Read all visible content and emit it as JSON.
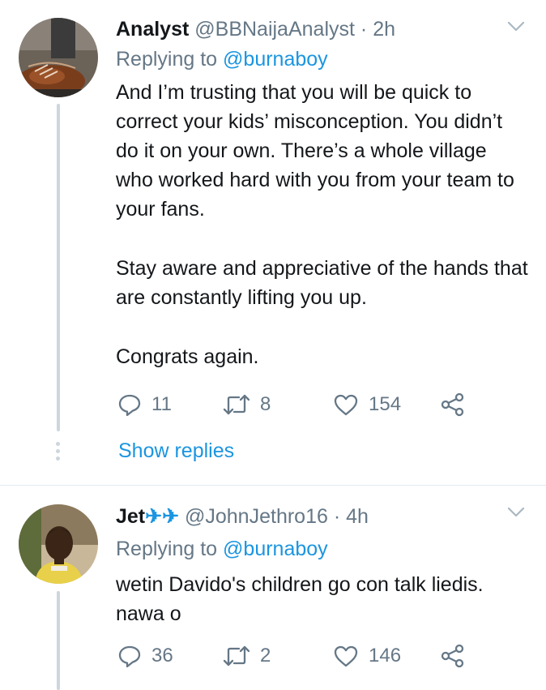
{
  "tweets": [
    {
      "name": "Analyst",
      "handle": "@BBNaijaAnalyst",
      "separator": "·",
      "time": "2h",
      "replying_prefix": "Replying to",
      "replying_to": "@burnaboy",
      "text_paragraphs": [
        "And I’m trusting that you will be quick to correct your kids’ misconception. You didn’t do it on your own. There’s a whole village who worked hard with you from your team to your fans.",
        "Stay aware and appreciative of the hands that are constantly lifting you up.",
        "Congrats again."
      ],
      "actions": {
        "replies": "11",
        "retweets": "8",
        "likes": "154"
      },
      "show_replies": "Show replies"
    },
    {
      "name": "Jet",
      "name_emoji": "✈✈",
      "handle": "@JohnJethro16",
      "separator": "·",
      "time": "4h",
      "replying_prefix": "Replying to",
      "replying_to": "@burnaboy",
      "text_paragraphs": [
        "wetin Davido's children go con talk liedis. nawa o"
      ],
      "actions": {
        "replies": "36",
        "retweets": "2",
        "likes": "146"
      }
    }
  ],
  "icons": [
    "reply-icon",
    "retweet-icon",
    "like-icon",
    "share-icon",
    "chevron-down-icon"
  ],
  "colors": {
    "link": "#1b95e0",
    "secondary_text": "#657786",
    "primary_text": "#14171a",
    "divider": "#e1e8ed"
  }
}
